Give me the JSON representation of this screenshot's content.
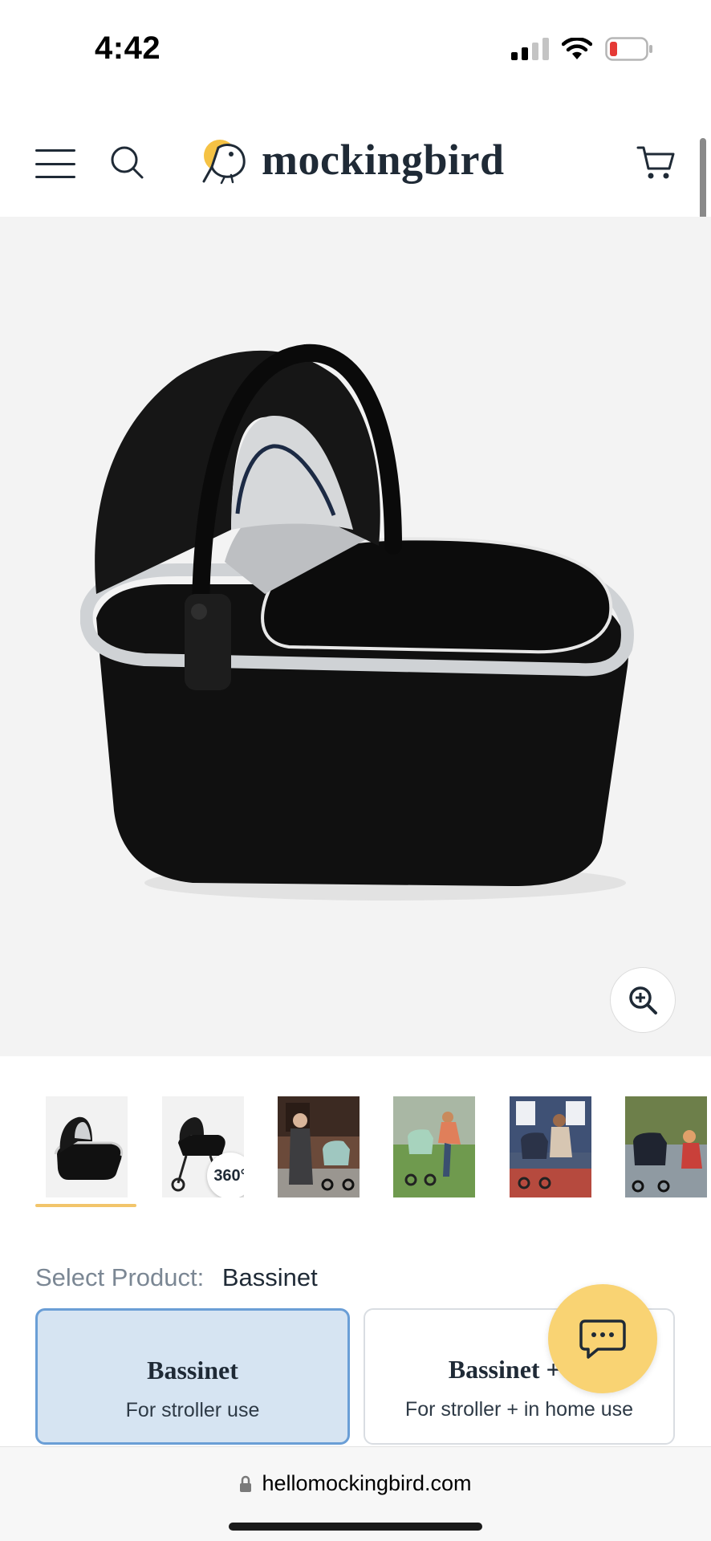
{
  "status_bar": {
    "time": "4:42",
    "icons": [
      "cellular-signal-icon",
      "wifi-icon",
      "battery-low-icon"
    ],
    "battery_color": "#e53935"
  },
  "header": {
    "brand": "mockingbird",
    "icons": [
      "menu-icon",
      "search-icon",
      "mockingbird-logo-icon",
      "cart-icon"
    ]
  },
  "product": {
    "image": "black stroller bassinet with silver trim",
    "zoom_icon": "zoom-in-icon"
  },
  "thumbnails": [
    {
      "alt": "bassinet product view",
      "selected": true
    },
    {
      "alt": "stroller with bassinet 360 view",
      "badge": "360°"
    },
    {
      "alt": "woman with stroller on street"
    },
    {
      "alt": "woman leaning over stroller on lawn"
    },
    {
      "alt": "mother with baby at stroller"
    },
    {
      "alt": "child in stroller outdoors"
    }
  ],
  "select_product": {
    "label": "Select Product:",
    "value": "Bassinet",
    "options": [
      {
        "title": "Bassinet",
        "subtitle": "For stroller use",
        "selected": true
      },
      {
        "title": "Bassinet + St",
        "subtitle": "For stroller + in home use",
        "selected": false
      }
    ]
  },
  "chat": {
    "icon": "chat-bubble-icon"
  },
  "browser": {
    "url": "hellomockingbird.com",
    "lock_icon": "lock-icon"
  },
  "colors": {
    "accent_yellow": "#f9d373",
    "thumb_underline": "#f2c56b",
    "selected_card_bg": "#d6e4f2",
    "selected_card_border": "#6a9ed6",
    "text_dark": "#1f2a36"
  }
}
